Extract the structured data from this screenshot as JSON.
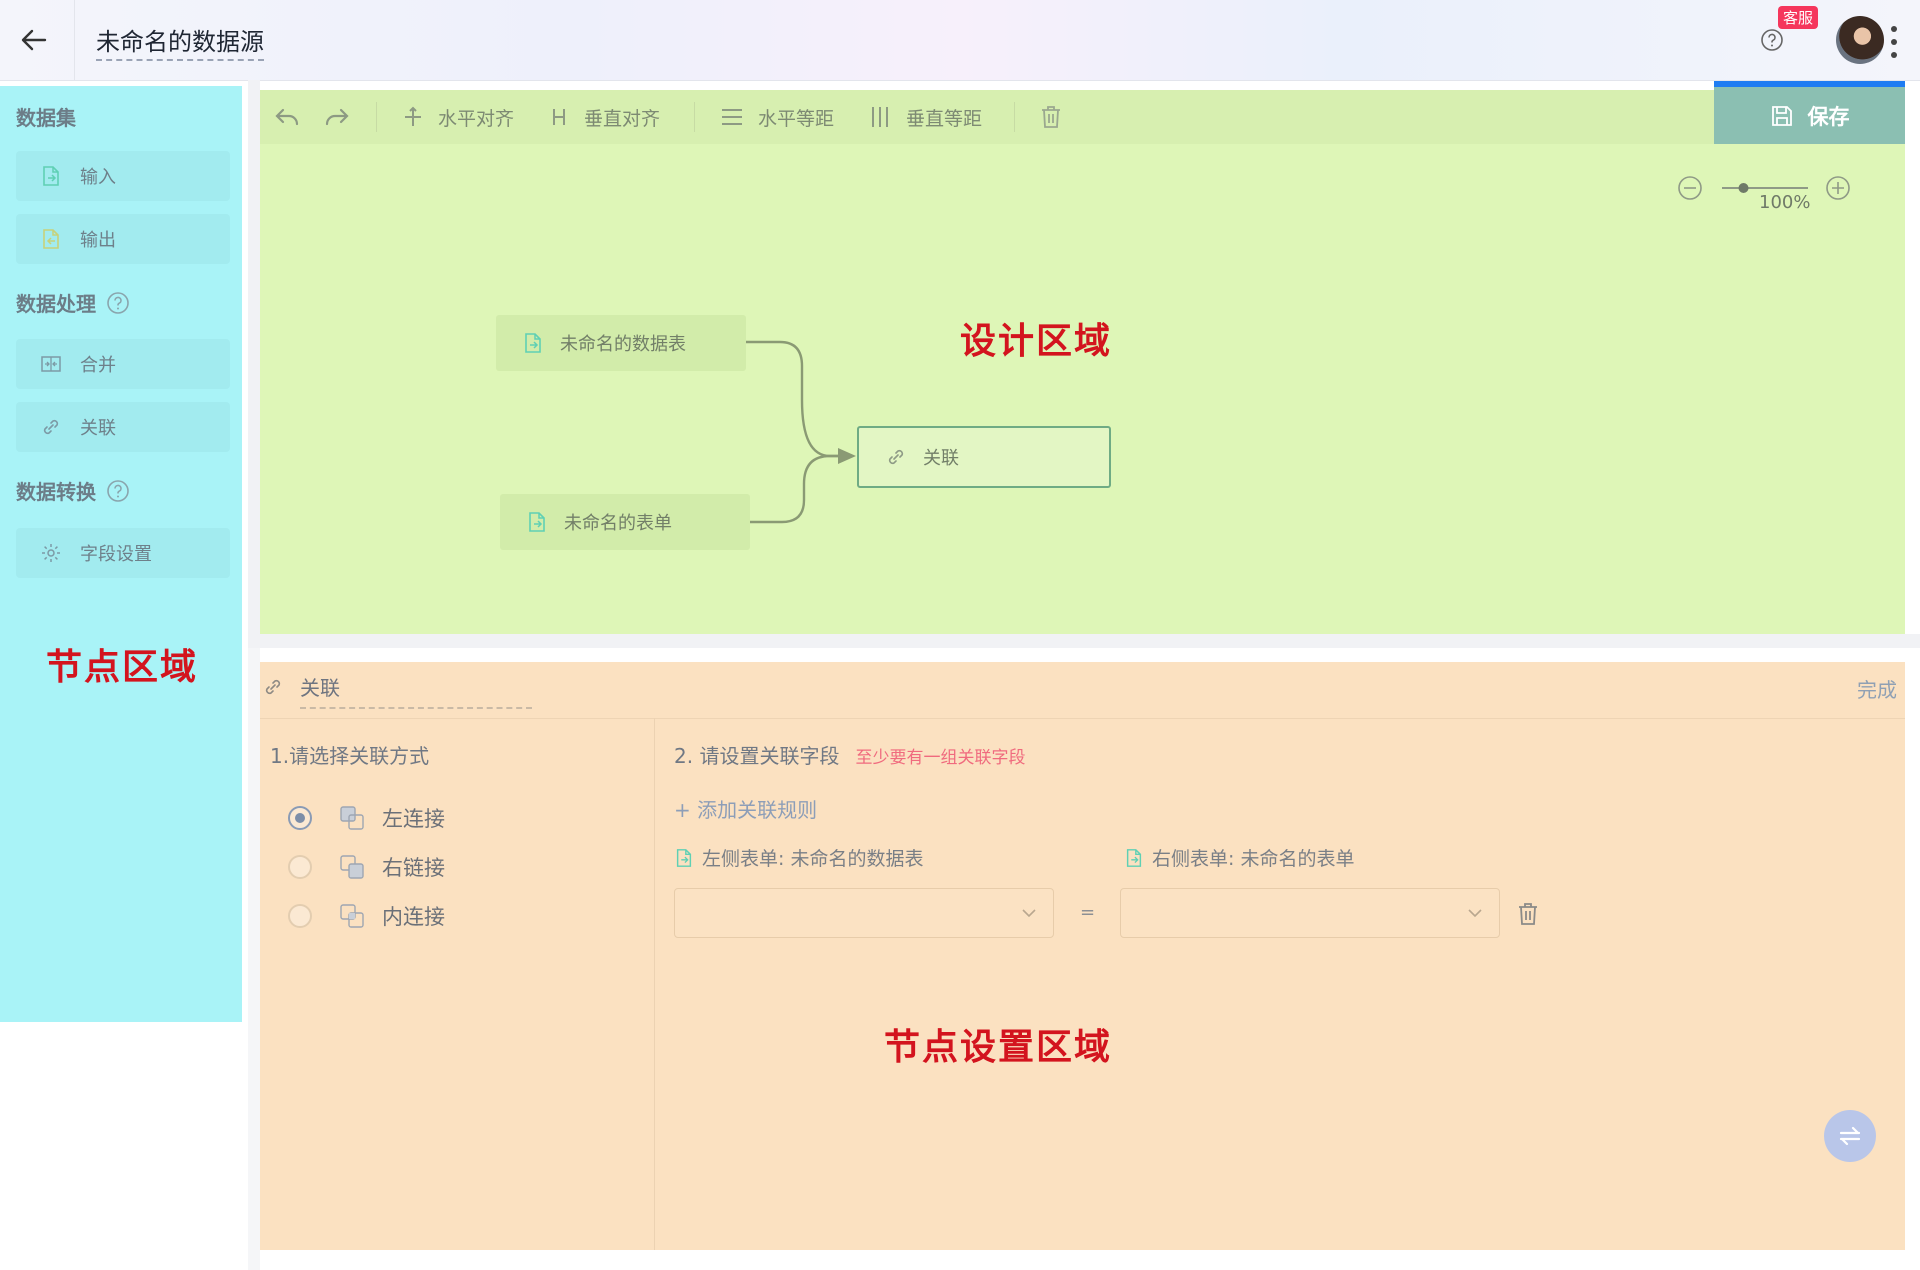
{
  "header": {
    "title": "未命名的数据源",
    "service_badge": "客服"
  },
  "left_panel": {
    "sections": [
      {
        "title": "数据集",
        "items": [
          {
            "label": "输入"
          },
          {
            "label": "输出"
          }
        ]
      },
      {
        "title": "数据处理",
        "items": [
          {
            "label": "合并"
          },
          {
            "label": "关联"
          }
        ]
      },
      {
        "title": "数据转换",
        "items": [
          {
            "label": "字段设置"
          }
        ]
      }
    ],
    "annotation": "节点区域"
  },
  "design": {
    "toolbar": {
      "align_horizontal": "水平对齐",
      "align_vertical": "垂直对齐",
      "space_horizontal": "水平等距",
      "space_vertical": "垂直等距",
      "save": "保存"
    },
    "zoom": "100%",
    "zoom_fraction": 0.25,
    "nodes": {
      "source_table": "未命名的数据表",
      "source_form": "未命名的表单",
      "join": "关联"
    },
    "annotation": "设计区域"
  },
  "settings": {
    "title": "关联",
    "finish": "完成",
    "step1": "1.请选择关联方式",
    "join_types": [
      {
        "label": "左连接",
        "selected": true
      },
      {
        "label": "右链接",
        "selected": false
      },
      {
        "label": "内连接",
        "selected": false
      }
    ],
    "step2": "2. 请设置关联字段",
    "warning": "至少要有一组关联字段",
    "add_rule": "+ 添加关联规则",
    "left_table": "左侧表单: 未命名的数据表",
    "right_table": "右侧表单: 未命名的表单",
    "equals": "=",
    "annotation": "节点设置区域"
  },
  "colors": {
    "node_panel": "#a9f3f7",
    "design_area": "#def6b7",
    "settings_area": "#fbe1c1",
    "annotation": "#d3141e",
    "save_accent": "#1e7cf2"
  }
}
